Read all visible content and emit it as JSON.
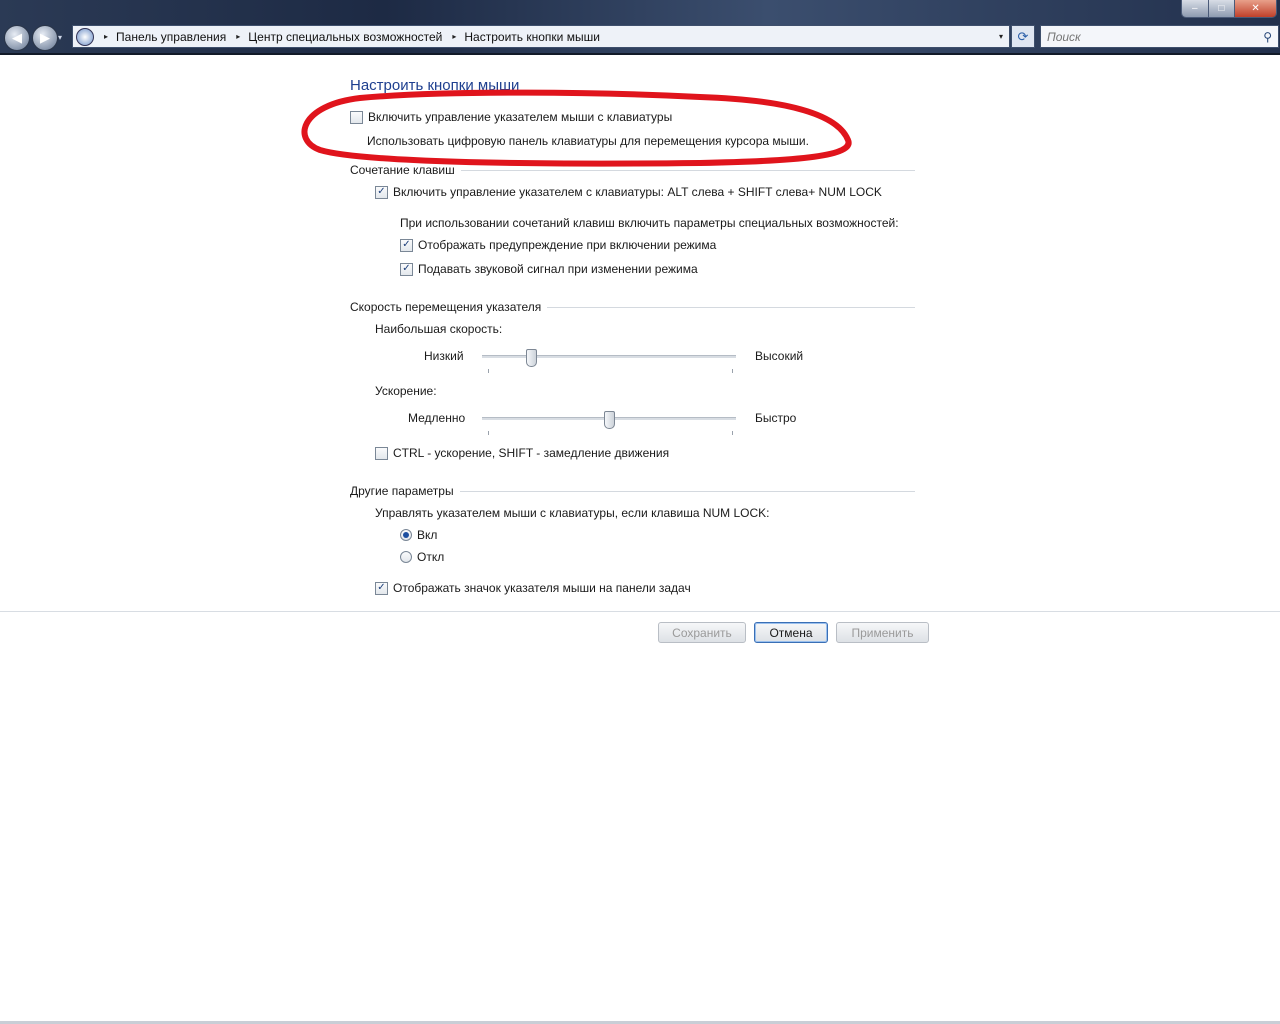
{
  "window": {
    "controls": {
      "minimize": "–",
      "maximize": "□",
      "close": "✕"
    }
  },
  "nav": {
    "back_icon": "◀",
    "forward_icon": "▶",
    "dropdown_icon": "▾"
  },
  "breadcrumb": {
    "items": [
      "Панель управления",
      "Центр специальных возможностей",
      "Настроить кнопки мыши"
    ],
    "separator": "▸",
    "dropdown_icon": "▾",
    "refresh_icon": "⟳"
  },
  "search": {
    "placeholder": "Поиск",
    "icon": "⚲"
  },
  "page": {
    "title": "Настроить кнопки мыши",
    "enable_mousekeys": {
      "label": "Включить управление указателем мыши с клавиатуры",
      "checked": false
    },
    "description": "Использовать цифровую панель клавиатуры для перемещения курсора мыши."
  },
  "shortcut": {
    "heading": "Сочетание клавиш",
    "enable_shortcut": {
      "label": "Включить управление указателем с клавиатуры: ALT слева + SHIFT слева+ NUM LOCK",
      "checked": true
    },
    "subheading": "При использовании сочетаний клавиш включить параметры специальных возможностей:",
    "show_warning": {
      "label": "Отображать предупреждение при включении режима",
      "checked": true
    },
    "play_sound": {
      "label": "Подавать звуковой сигнал при изменении режима",
      "checked": true
    }
  },
  "speed": {
    "heading": "Скорость перемещения указателя",
    "top_speed_label": "Наибольшая скорость:",
    "top_speed_low": "Низкий",
    "top_speed_high": "Высокий",
    "top_speed_value": 0.18,
    "accel_label": "Ускорение:",
    "accel_low": "Медленно",
    "accel_high": "Быстро",
    "accel_value": 0.5,
    "ctrl_shift": {
      "label": "CTRL - ускорение, SHIFT - замедление движения",
      "checked": false
    }
  },
  "other": {
    "heading": "Другие параметры",
    "numlock_label": "Управлять указателем мыши с клавиатуры, если клавиша NUM LOCK:",
    "on_label": "Вкл",
    "off_label": "Откл",
    "selected": "on",
    "show_tray_icon": {
      "label": "Отображать значок указателя мыши на панели задач",
      "checked": true
    }
  },
  "buttons": {
    "save": "Сохранить",
    "cancel": "Отмена",
    "apply": "Применить"
  },
  "annotation_color": "#e0141c"
}
